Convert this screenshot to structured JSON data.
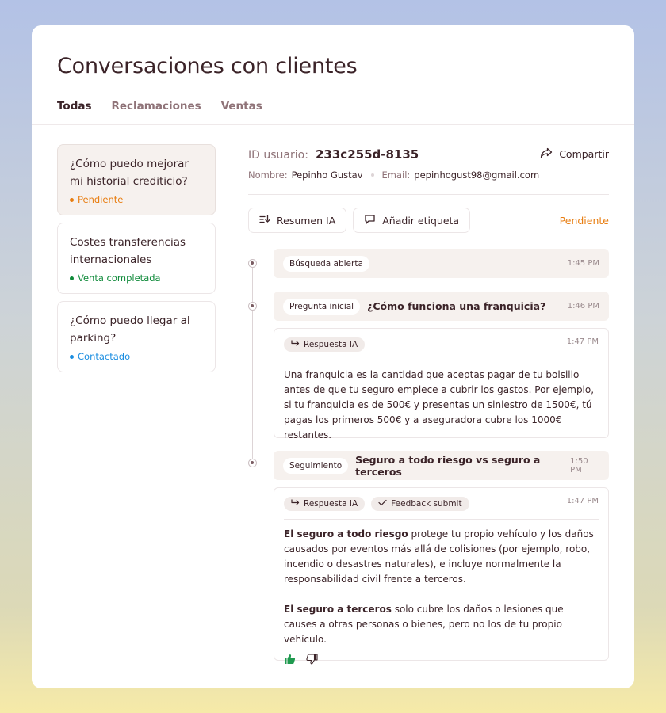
{
  "page": {
    "title": "Conversaciones con clientes",
    "tabs": [
      "Todas",
      "Reclamaciones",
      "Ventas"
    ]
  },
  "conversations": [
    {
      "title": "¿Cómo puedo mejorar mi historial crediticio?",
      "status": "Pendiente",
      "status_color": "#e87d10"
    },
    {
      "title": "Costes transferencias internacionales",
      "status": "Venta completada",
      "status_color": "#0f8a3a"
    },
    {
      "title": "¿Cómo puedo llegar al parking?",
      "status": "Contactado",
      "status_color": "#1a8de0"
    }
  ],
  "detail": {
    "user_id_label": "ID usuario:",
    "user_id": "233c255d-8135",
    "share_label": "Compartir",
    "name_label": "Nombre:",
    "name": "Pepinho Gustav",
    "email_label": "Email:",
    "email": "pepinhogust98@gmail.com",
    "summary_button": "Resumen IA",
    "tag_button": "Añadir etiqueta",
    "status": "Pendiente"
  },
  "timeline": {
    "event1": {
      "chip": "Búsqueda abierta",
      "time": "1:45 PM"
    },
    "event2": {
      "chip": "Pregunta inicial",
      "question": "¿Cómo funciona una franquicia?",
      "time": "1:46 PM"
    },
    "response1": {
      "chip": "Respuesta IA",
      "time": "1:47 PM",
      "text": "Una franquicia es la cantidad que aceptas pagar de tu bolsillo antes de que tu seguro empiece a cubrir los gastos. Por ejemplo, si tu franquicia es de 500€ y presentas un siniestro de 1500€, tú pagas los primeros 500€ y a aseguradora cubre los 1000€ restantes."
    },
    "event3": {
      "chip": "Seguimiento",
      "question": "Seguro a todo riesgo vs seguro a terceros",
      "time": "1:50 PM"
    },
    "response2": {
      "chip": "Respuesta IA",
      "feedback_chip": "Feedback submit",
      "time": "1:47 PM",
      "p1_bold": "El seguro a todo riesgo",
      "p1_rest": " protege tu propio vehículo y los daños causados por eventos más allá de colisiones (por ejemplo, robo, incendio o desastres naturales), e incluye normalmente la responsabilidad civil frente a terceros.",
      "p2_bold": "El seguro a terceros",
      "p2_rest": " solo cubre los daños o lesiones que causes a otras personas o bienes, pero no los de tu propio vehículo."
    }
  },
  "colors": {
    "accent_text": "#3b2328",
    "muted_text": "#8f7378",
    "pending": "#e87d10",
    "thumbs_up": "#1f9a4f"
  }
}
